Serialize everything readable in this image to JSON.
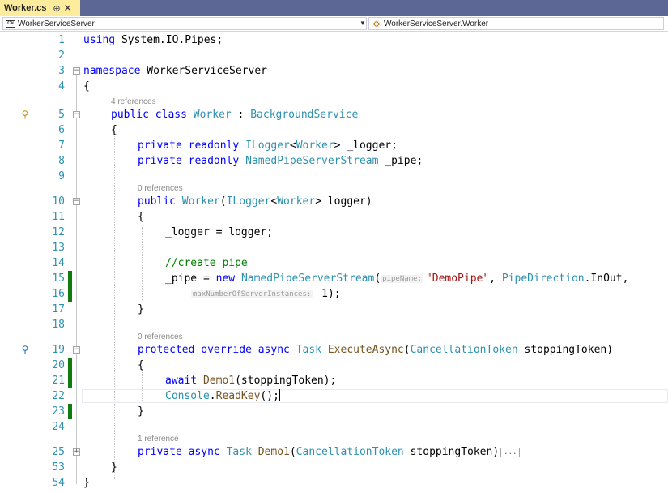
{
  "tab": {
    "title": "Worker.cs",
    "pin": "⊕",
    "close": "✕"
  },
  "nav": {
    "project": "WorkerServiceServer",
    "class": "WorkerServiceServer.Worker"
  },
  "codelens": {
    "class_refs": "4 references",
    "ctor_refs": "0 references",
    "exec_refs": "0 references",
    "demo_refs": "1 reference"
  },
  "lines": {
    "l1": "1",
    "l2": "2",
    "l3": "3",
    "l4": "4",
    "l5": "5",
    "l6": "6",
    "l7": "7",
    "l8": "8",
    "l9": "9",
    "l10": "10",
    "l11": "11",
    "l12": "12",
    "l13": "13",
    "l14": "14",
    "l15": "15",
    "l16": "16",
    "l17": "17",
    "l18": "18",
    "l19": "19",
    "l20": "20",
    "l21": "21",
    "l22": "22",
    "l23": "23",
    "l24": "24",
    "l25": "25",
    "l53": "53",
    "l54": "54"
  },
  "code": {
    "using_kw": "using",
    "using_ns": " System.IO.Pipes;",
    "ns_kw": "namespace",
    "ns_name": " WorkerServiceServer",
    "brace_open": "{",
    "brace_close": "}",
    "public": "public",
    "class": "class",
    "worker": "Worker",
    "colon": " : ",
    "bgservice": "BackgroundService",
    "private": "private",
    "readonly": "readonly",
    "ilogger": "ILogger",
    "logger_field": "> _logger;",
    "npss": "NamedPipeServerStream",
    "pipe_field": " _pipe;",
    "ctor_param": "> logger)",
    "assign_logger": "_logger = logger;",
    "comment": "//create pipe",
    "pipe_assign": "_pipe = ",
    "new": "new",
    "paren_open": "(",
    "hint_pipename": "pipeName:",
    "demopipe": "\"DemoPipe\"",
    "comma": ", ",
    "pipedir": "PipeDirection",
    "inout": ".InOut,",
    "hint_maxinst": "maxNumberOfServerInstances:",
    "one": " 1);",
    "protected": "protected",
    "override": "override",
    "async": "async",
    "task": "Task",
    "execasync": "ExecuteAsync",
    "ctoken": "CancellationToken",
    "stoptoken_param": " stoppingToken)",
    "await": "await",
    "demo1": "Demo1",
    "demo1_call": "(stoppingToken);",
    "console": "Console",
    "readkey": "ReadKey",
    "readkey_tail": "();",
    "collapsed": "..."
  }
}
